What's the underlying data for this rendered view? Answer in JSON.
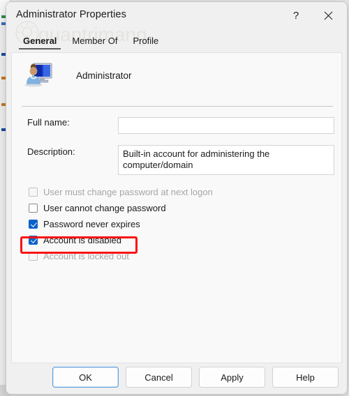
{
  "window": {
    "title": "Administrator Properties",
    "help_icon": "?",
    "help_icon_name": "question-mark-icon",
    "close_icon": "×",
    "close_icon_name": "close-icon"
  },
  "watermark": {
    "text": "quantrimang",
    "logo": "lightbulb-icon"
  },
  "tabs": [
    {
      "label": "General",
      "selected": true
    },
    {
      "label": "Member Of",
      "selected": false
    },
    {
      "label": "Profile",
      "selected": false
    }
  ],
  "general": {
    "account_icon": "user-account-monitor-icon",
    "account_name": "Administrator",
    "fields": [
      {
        "label": "Full name:",
        "value": "",
        "placeholder": ""
      },
      {
        "label": "Description:",
        "value": "Built-in account for administering the computer/domain",
        "placeholder": ""
      }
    ],
    "checkboxes": [
      {
        "label": "User must change password at next logon",
        "checked": false,
        "disabled": true
      },
      {
        "label": "User cannot change password",
        "checked": false,
        "disabled": false
      },
      {
        "label": "Password never expires",
        "checked": true,
        "disabled": false
      },
      {
        "label": "Account is disabled",
        "checked": true,
        "disabled": false,
        "highlighted": true
      },
      {
        "label": "Account is locked out",
        "checked": false,
        "disabled": true
      }
    ]
  },
  "footer": {
    "buttons": [
      {
        "label": "OK",
        "default": true
      },
      {
        "label": "Cancel",
        "default": false
      },
      {
        "label": "Apply",
        "default": false
      },
      {
        "label": "Help",
        "default": false
      }
    ]
  },
  "colors": {
    "accent_blue": "#0a62c8",
    "highlight_red": "#f91313",
    "dialog_bg": "#f0f0f0",
    "panel_bg": "#f9f9f9",
    "focus_border": "#5c9ee0"
  }
}
